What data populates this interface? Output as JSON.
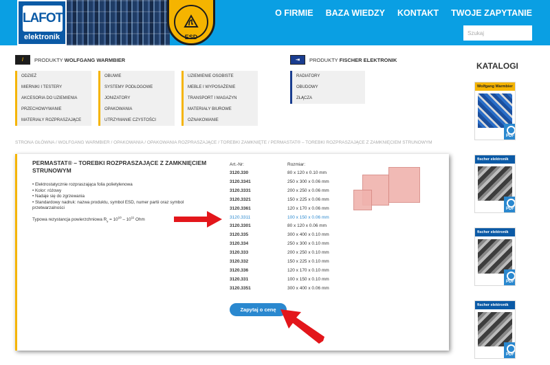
{
  "header": {
    "logo_text": "LAFOT",
    "logo_sub": "elektronik",
    "esd_label": "ESD",
    "nav": [
      "O FIRMIE",
      "BAZA WIEDZY",
      "KONTAKT",
      "TWOJE ZAPYTANIE"
    ],
    "search_placeholder": "Szukaj"
  },
  "menus": {
    "warmbier": {
      "heading_prefix": "PRODUKTY ",
      "heading_brand": "WOLFGANG WARMBIER",
      "col1": [
        "ODZIEŻ",
        "MIERNIKI I TESTERY",
        "AKCESORIA DO UZIEMIENIA",
        "PRZECHOWYWANIE",
        "MATERIAŁY ROZPRASZAJĄCE"
      ],
      "col2": [
        "OBUWIE",
        "SYSTEMY PODŁOGOWE",
        "JONIZATORY",
        "OPAKOWANIA",
        "UTRZYMANIE CZYSTOŚCI"
      ],
      "col3": [
        "UZIEMIENIE OSOBISTE",
        "MEBLE I WYPOSAŻENIE",
        "TRANSPORT I MAGAZYN",
        "MATERIAŁY BIUROWE",
        "OZNAKOWANIE"
      ]
    },
    "fischer": {
      "heading_prefix": "PRODUKTY ",
      "heading_brand": "FISCHER ELEKTRONIK",
      "col1": [
        "RADIATORY",
        "OBUDOWY",
        "ZŁĄCZA"
      ]
    }
  },
  "katalogi": {
    "title": "KATALOGI",
    "pdf_label": "PDF",
    "covers": [
      "Wolfgang Warmbier",
      "fischer elektronik",
      "fischer elektronik",
      "fischer elektronik"
    ]
  },
  "breadcrumb": "STRONA GŁÓWNA / WOLFGANG WARMBIER / OPAKOWANIA / OPAKOWANIA ROZPRASZAJĄCE / TOREBKI ZAMKNIĘTE / PERMASTAT® – TOREBKI ROZPRASZAJĄCE Z ZAMKNIĘCIEM STRUNOWYM",
  "product": {
    "title": "PERMASTAT® – TOREBKI ROZPRASZAJĄCE Z ZAMKNIĘCIEM STRUNOWYM",
    "features": [
      "• Elektrostatycznie rozpraszająca folia polietylenowa",
      "• Kolor: różowy",
      "• Nadaje się do zgrzewania",
      "• Standardowy nadruk: nazwa produktu, symbol ESD, numer partii oraz symbol przetwarzalności"
    ],
    "resistance_text": "Typowa rezystancja powierzchniowa R",
    "resistance_sub": "s",
    "resistance_values": " = 10",
    "resistance_exp1": "10",
    "resistance_mid": " – 10",
    "resistance_exp2": "11",
    "resistance_unit": " Ohm",
    "table_headers": {
      "art": "Art.-Nr:",
      "size": "Rozmiar:"
    },
    "rows": [
      {
        "art": "3120.330",
        "size": "80 x 120 x 0.10 mm"
      },
      {
        "art": "3120.3341",
        "size": "250 x 300 x 0.06 mm"
      },
      {
        "art": "3120.3331",
        "size": "200 x 250 x 0.06 mm"
      },
      {
        "art": "3120.3321",
        "size": "150 x 225 x 0.06 mm"
      },
      {
        "art": "3120.3361",
        "size": "120 x 170 x 0.06 mm"
      },
      {
        "art": "3120.3311",
        "size": "100 x 150 x 0.06 mm"
      },
      {
        "art": "3120.3301",
        "size": "80 x 120 x 0.06 mm"
      },
      {
        "art": "3120.335",
        "size": "300 x 400 x 0.10 mm"
      },
      {
        "art": "3120.334",
        "size": "250 x 300 x 0.10 mm"
      },
      {
        "art": "3120.333",
        "size": "200 x 250 x 0.10 mm"
      },
      {
        "art": "3120.332",
        "size": "150 x 225 x 0.10 mm"
      },
      {
        "art": "3120.336",
        "size": "120 x 170 x 0.10 mm"
      },
      {
        "art": "3120.331",
        "size": "100 x 150 x 0.10 mm"
      },
      {
        "art": "3120.3351",
        "size": "300 x 400 x 0.06 mm"
      }
    ],
    "highlighted_row": "3120.3311",
    "quote_button": "Zapytaj o cenę"
  },
  "colors": {
    "header_blue": "#0a9fe3",
    "accent_yellow": "#f5b400",
    "link_blue": "#2a88cf",
    "arrow_red": "#e3161b"
  }
}
